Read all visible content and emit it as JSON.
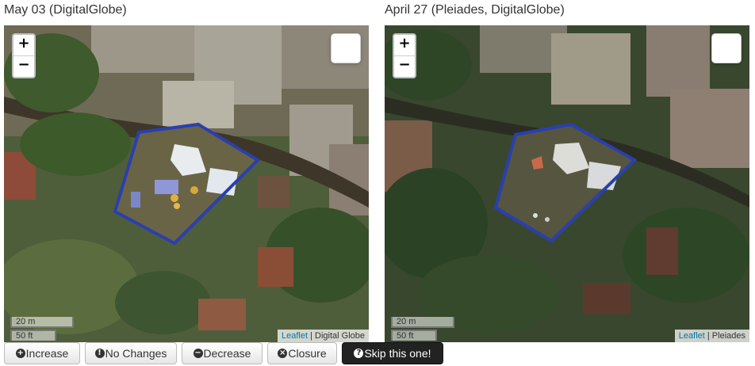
{
  "left_map": {
    "title": "May 03 (DigitalGlobe)",
    "zoom_in": "+",
    "zoom_out": "−",
    "scale_metric": "20 m",
    "scale_imperial": "50 ft",
    "attribution_link": "Leaflet",
    "attribution_source": "Digital Globe"
  },
  "right_map": {
    "title": "April 27 (Pleiades, DigitalGlobe)",
    "zoom_in": "+",
    "zoom_out": "−",
    "scale_metric": "20 m",
    "scale_imperial": "50 ft",
    "attribution_link": "Leaflet",
    "attribution_source": "Pleiades"
  },
  "colors": {
    "polygon": "#2a3fb0",
    "dark_button": "#222222"
  },
  "buttons": [
    {
      "label": "Increase",
      "icon": "plus-circle-icon",
      "glyph": "+"
    },
    {
      "label": "No Changes",
      "icon": "info-circle-icon",
      "glyph": "!"
    },
    {
      "label": "Decrease",
      "icon": "minus-circle-icon",
      "glyph": "−"
    },
    {
      "label": "Closure",
      "icon": "close-circle-icon",
      "glyph": "×"
    },
    {
      "label": "Skip this one!",
      "icon": "question-circle-icon",
      "glyph": "?"
    }
  ]
}
